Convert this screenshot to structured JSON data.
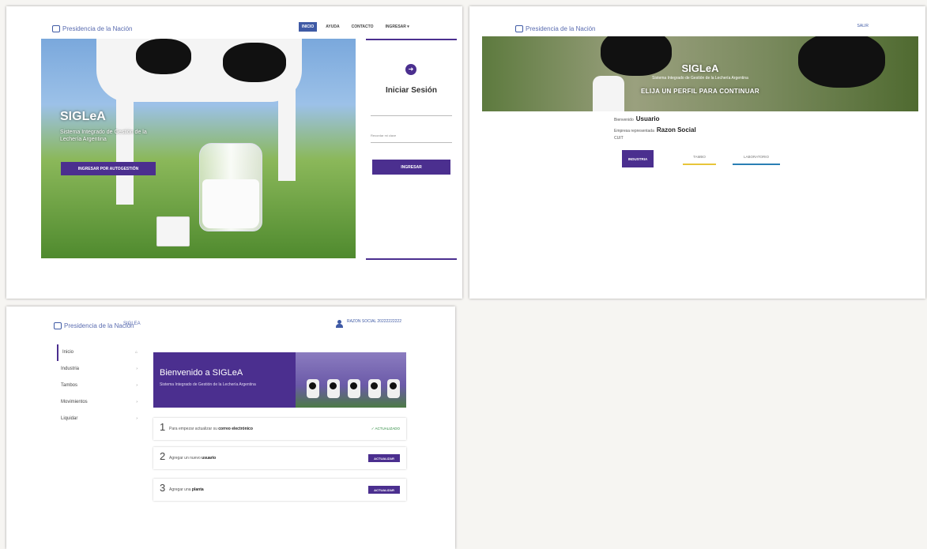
{
  "background_text": {
    "top": "...",
    "right_lines": [
      "",
      "",
      "",
      "",
      ""
    ]
  },
  "brand": "Presidencia de la Nación",
  "login_page": {
    "nav": [
      "INICIO",
      "AYUDA",
      "CONTACTO",
      "INGRESAR ▾"
    ],
    "hero_title": "SIGLeA",
    "hero_subtitle": "Sistema Integrado de Gestión de la Lechería Argentina",
    "autogestion_button": "INGRESAR POR AUTOGESTIÓN",
    "login_title": "Iniciar Sesión",
    "user_field": "",
    "password_field": "Recordar mi clave",
    "login_button": "INGRESAR",
    "help_text": "",
    "forgot_text": "",
    "footer_lines": [
      "",
      ""
    ]
  },
  "profile_page": {
    "login_link": "SALIR",
    "banner_title": "SIGLeA",
    "banner_subtitle": "Sistema Integrado de Gestión de la Lechería Argentina",
    "banner_choose": "ELIJA UN PERFIL PARA CONTINUAR",
    "welcome_label": "Bienvenido",
    "welcome_user": "Usuario",
    "company_label": "Empresa representada",
    "company_value": "Razon Social",
    "cuit_label": "CUIT",
    "cuit_value": "",
    "profiles": [
      "INDUSTRIA",
      "TAMBO",
      "LABORATORIO"
    ],
    "footer_lines": [
      "",
      ""
    ]
  },
  "dashboard_page": {
    "app_tag": "SIGLEA",
    "user_line1": "",
    "user_line2": "RAZON SOCIAL 20222222222",
    "menu": [
      "Inicio",
      "Industria",
      "Tambos",
      "Movimientos",
      "Liquidar"
    ],
    "welcome_title": "Bienvenido a SIGLeA",
    "welcome_subtitle": "Sistema Integrado de Gestión de la Lechería Argentina",
    "steps": [
      {
        "num": "1",
        "text": "Para empezar actualizar su",
        "bold": "correo electrónico",
        "status": "✓ ACTUALIZADO"
      },
      {
        "num": "2",
        "text": "Agregar un nuevo",
        "bold": "usuario",
        "action": "ACTUALIZAR"
      },
      {
        "num": "3",
        "text": "Agregar una",
        "bold": "planta",
        "action": "ACTUALIZAR"
      }
    ]
  },
  "colors": {
    "purple": "#4b2f8f",
    "blue": "#3f5aa5",
    "yellow": "#e8c53a",
    "teal": "#2a7fb4"
  }
}
